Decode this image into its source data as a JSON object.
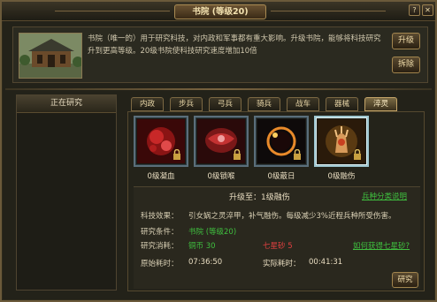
{
  "title": "书院 (等级20)",
  "help_icon": "?",
  "close_icon": "✕",
  "info": {
    "description": "书院（唯一的）用于研究科技，对内政和军事都有重大影响。升级书院，能够将科技研究升到更高等级。20级书院使科技研究速度增加10倍",
    "upgrade_button": "升级",
    "demolish_button": "拆除"
  },
  "left_panel": {
    "header": "正在研究"
  },
  "tabs": [
    "内政",
    "步兵",
    "弓兵",
    "骑兵",
    "战车",
    "器械",
    "淬灵"
  ],
  "active_tab": 6,
  "skills": [
    {
      "label": "0级凝血",
      "icon": "blood-clot-icon"
    },
    {
      "label": "0级锁喉",
      "icon": "choke-icon"
    },
    {
      "label": "0级蔽日",
      "icon": "eclipse-icon"
    },
    {
      "label": "0级融伤",
      "icon": "heal-wound-icon"
    }
  ],
  "selected_skill": 3,
  "details": {
    "upgrade_to_label": "升级至：",
    "upgrade_to_value": "1级融伤",
    "class_link": "兵种分类说明",
    "effect_label": "科技效果：",
    "effect_value": "引女娲之灵淬甲，补气融伤。每级减少3%近程兵种所受伤害。",
    "condition_label": "研究条件：",
    "condition_value": "书院 (等级20)",
    "cost_label": "研究消耗：",
    "cost_value": "铜币  30",
    "star_cost": "七星砂 5",
    "star_link": "如何获得七星砂?",
    "base_time_label": "原始耗时：",
    "base_time_value": "07:36:50",
    "real_time_label": "实际耗时：",
    "real_time_value": "00:41:31",
    "research_button": "研究"
  },
  "colors": {
    "green": "#3fbf3f",
    "red": "#e04040",
    "gold_border": "#a2854e"
  }
}
